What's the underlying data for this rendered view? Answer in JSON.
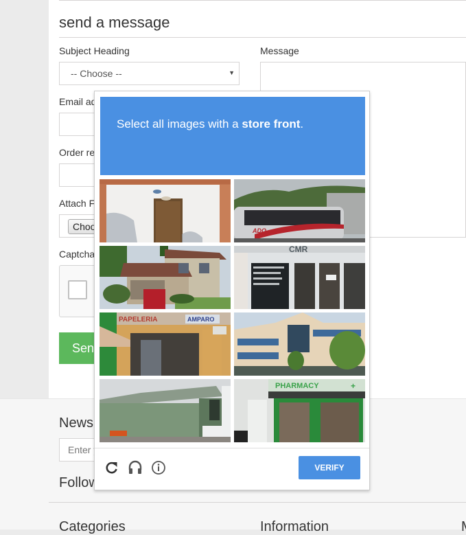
{
  "form": {
    "title": "send a message",
    "subject_label": "Subject Heading",
    "subject_selected": "-- Choose --",
    "message_label": "Message",
    "email_label": "Email address",
    "order_label": "Order reference",
    "attach_label": "Attach File",
    "file_button": "Choose File",
    "captcha_label": "Captcha",
    "send_button": "Send"
  },
  "footer": {
    "newsletter_title": "Newsletter",
    "newsletter_placeholder": "Enter your e-mail",
    "follow_title": "Follow us",
    "columns": [
      "Categories",
      "Information",
      "My account"
    ]
  },
  "recaptcha": {
    "instruction_prefix": "Select all images with a ",
    "instruction_target": "store front",
    "instruction_suffix": ".",
    "verify_label": "VERIFY",
    "accent_color": "#4a90e2",
    "icons": [
      "reload-icon",
      "audio-icon",
      "info-icon"
    ],
    "tiles": [
      {
        "subject": "white wall with wooden door"
      },
      {
        "subject": "ADO bus on road"
      },
      {
        "subject": "suburban house with red car"
      },
      {
        "subject": "glass shop front with sign"
      },
      {
        "subject": "Papeleria Amparo store front"
      },
      {
        "subject": "office building"
      },
      {
        "subject": "green warehouse"
      },
      {
        "subject": "pharmacy store front"
      }
    ]
  }
}
